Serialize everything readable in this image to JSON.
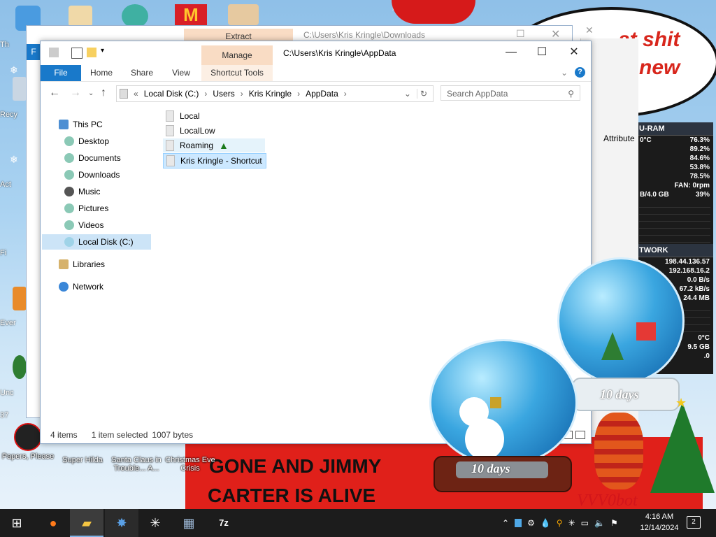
{
  "desktop": {
    "speech_lines": [
      "at shit",
      "new"
    ],
    "banner_lines": [
      "GONE AND JIMMY",
      "CARTER IS ALIVE"
    ],
    "left_labels": [
      "Th",
      "Recy",
      "Act",
      "Fi",
      "Ever",
      "Unc",
      "37"
    ],
    "icons": [
      {
        "label": "Papers, Please"
      },
      {
        "label": "Super Hilda"
      },
      {
        "label": "Santa Claus in Trouble... A..."
      },
      {
        "label": "Christmas Eve Crisis"
      }
    ],
    "watermark": "VVV0bot"
  },
  "bg_window": {
    "tab": "Extract",
    "title": "C:\\Users\\Kris Kringle\\Downloads",
    "column": "Attribute",
    "left_letter": "F"
  },
  "gadget": {
    "cpu_header": "U-RAM",
    "temp": "0°C",
    "cpu_total": "76.3%",
    "cores": [
      "89.2%",
      "84.6%",
      "53.8%",
      "78.5%"
    ],
    "fan": "FAN: 0rpm",
    "ram": "B/4.0 GB",
    "ram_pct": "39%",
    "net_header": "TWORK",
    "ip1": "198.44.136.57",
    "ip2": "192.168.16.2",
    "up": "0.0 B/s",
    "down": "67.2 kB/s",
    "total": "24.4 MB",
    "temp2": "0°C",
    "disk": "9.5 GB",
    "disk2": ".0"
  },
  "window": {
    "manage_tab": "Manage",
    "title": "C:\\Users\\Kris Kringle\\AppData",
    "ribbon_tabs": [
      "File",
      "Home",
      "Share",
      "View",
      "Shortcut Tools"
    ],
    "breadcrumb": [
      "Local Disk (C:)",
      "Users",
      "Kris Kringle",
      "AppData"
    ],
    "search_placeholder": "Search AppData",
    "nav": [
      {
        "label": "This PC"
      },
      {
        "label": "Desktop"
      },
      {
        "label": "Documents"
      },
      {
        "label": "Downloads"
      },
      {
        "label": "Music"
      },
      {
        "label": "Pictures"
      },
      {
        "label": "Videos"
      },
      {
        "label": "Local Disk (C:)"
      },
      {
        "label": "Libraries"
      },
      {
        "label": "Network"
      }
    ],
    "files": [
      {
        "name": "Local"
      },
      {
        "name": "LocalLow"
      },
      {
        "name": "Roaming"
      },
      {
        "name": "Kris Kringle - Shortcut"
      }
    ],
    "status": {
      "count": "4 items",
      "selected": "1 item selected",
      "size": "1007 bytes"
    }
  },
  "globes": {
    "label_left": "10 days",
    "label_right": "10 days"
  },
  "taskbar": {
    "time": "4:16 AM",
    "date": "12/14/2024",
    "notif_count": "2"
  }
}
